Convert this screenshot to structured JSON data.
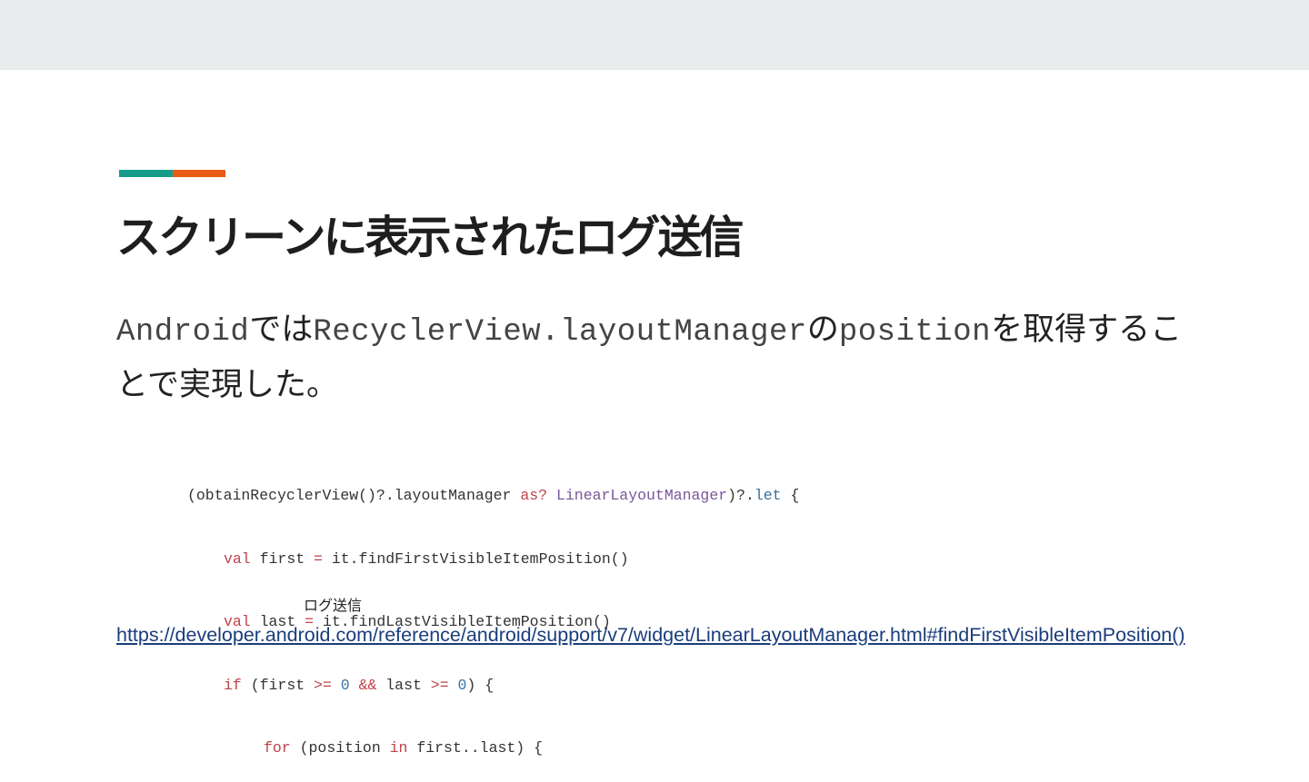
{
  "slide": {
    "title": "スクリーンに表示されたログ送信",
    "body": {
      "part1": "Android",
      "part2": "では",
      "part3": "RecyclerView.layoutManager",
      "part4": "の",
      "part5": "position",
      "part6": "を取得することで実現した。"
    },
    "code": {
      "line1": {
        "a": "(obtainRecyclerView()?.layoutManager ",
        "b": "as?",
        "c": " ",
        "d": "LinearLayoutManager",
        "e": ")?.",
        "f": "let",
        "g": " {"
      },
      "line2": {
        "a": "val",
        "b": " first ",
        "c": "=",
        "d": " it.findFirstVisibleItemPosition()"
      },
      "line3": {
        "a": "val",
        "b": " last ",
        "c": "=",
        "d": " it.findLastVisibleItemPosition()"
      },
      "line4": {
        "a": "if",
        "b": " (first ",
        "c": ">=",
        "d": " ",
        "e": "0",
        "f": " ",
        "g": "&&",
        "h": " last ",
        "i": ">=",
        "j": " ",
        "k": "0",
        "l": ") {"
      },
      "line5": {
        "a": "for",
        "b": " (position ",
        "c": "in",
        "d": " first..last) {"
      },
      "comment": "ログ送信"
    },
    "link": "https://developer.android.com/reference/android/support/v7/widget/LinearLayoutManager.html#findFirstVisibleItemPosition()"
  },
  "colors": {
    "accent_teal": "#179c8c",
    "accent_orange": "#e85c14",
    "keyword": "#c0444a",
    "type": "#7b559c",
    "number": "#3a74a8",
    "link": "#1a3d7c"
  }
}
